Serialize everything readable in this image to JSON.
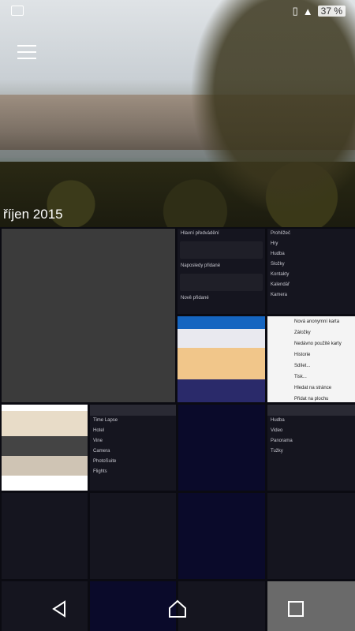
{
  "status": {
    "battery": "37 %"
  },
  "gallery": {
    "album_title": "říjen 2015"
  },
  "tiles": {
    "settings": {
      "header": "Hlavní předvádění",
      "section1": "Naposledy přidané",
      "section2": "Nově přidané"
    },
    "apps": [
      "Prohlížeč",
      "Hry",
      "Hudba",
      "Složky",
      "Kontakty",
      "Kalendář",
      "Kamera"
    ],
    "browser_menu": [
      "Nová anonymní karta",
      "Záložky",
      "Nedávno použité karty",
      "Historie",
      "Sdílet...",
      "Tisk...",
      "Hledat na stránce",
      "Přidat na plochu"
    ],
    "app_grid": [
      "Time Lapse",
      "Hotel",
      "Vine",
      "Camera",
      "PhotoSuite",
      "Flights"
    ],
    "widgets": [
      "Hudba",
      "Video",
      "Panorama",
      "Tužky"
    ]
  },
  "navbar": {
    "back": "back",
    "home": "home",
    "recents": "recents"
  }
}
